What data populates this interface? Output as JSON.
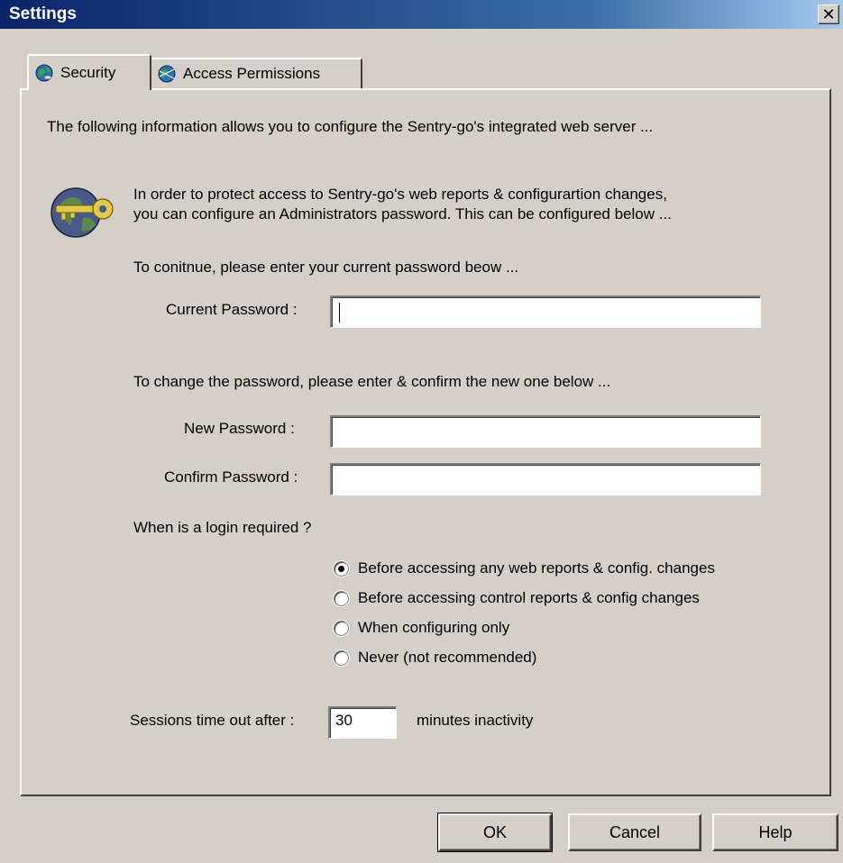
{
  "window": {
    "title": "Settings",
    "close_label": "✕"
  },
  "tabs": [
    {
      "label": "Security",
      "active": true
    },
    {
      "label": "Access Permissions",
      "active": false
    }
  ],
  "security": {
    "intro": "The following information allows you to configure the Sentry-go's integrated web server ...",
    "protect_line1": "In order to protect access to Sentry-go's web reports & configurartion changes,",
    "protect_line2": "you can configure an Administrators password. This can be configured below ...",
    "continue_text": "To conitnue, please enter your current password beow ...",
    "current_password_label": "Current Password :",
    "current_password_value": "",
    "change_text": "To change the password, please enter & confirm the new one below ...",
    "new_password_label": "New Password :",
    "new_password_value": "",
    "confirm_password_label": "Confirm Password :",
    "confirm_password_value": "",
    "login_question": "When is a login required ?",
    "login_options": [
      {
        "label": "Before accessing any web reports & config. changes",
        "checked": true
      },
      {
        "label": "Before accessing control reports & config changes",
        "checked": false
      },
      {
        "label": "When configuring only",
        "checked": false
      },
      {
        "label": "Never (not recommended)",
        "checked": false
      }
    ],
    "timeout_label": "Sessions time out after :",
    "timeout_value": "30",
    "timeout_suffix": "minutes inactivity"
  },
  "buttons": {
    "ok": "OK",
    "cancel": "Cancel",
    "help": "Help"
  },
  "colors": {
    "titlebar": "#0a246a",
    "dialog_bg": "#d4d0c8"
  },
  "icons": {
    "tab_security": "globe-icon",
    "tab_access": "globe-network-icon",
    "security_key": "key-globe-icon"
  }
}
